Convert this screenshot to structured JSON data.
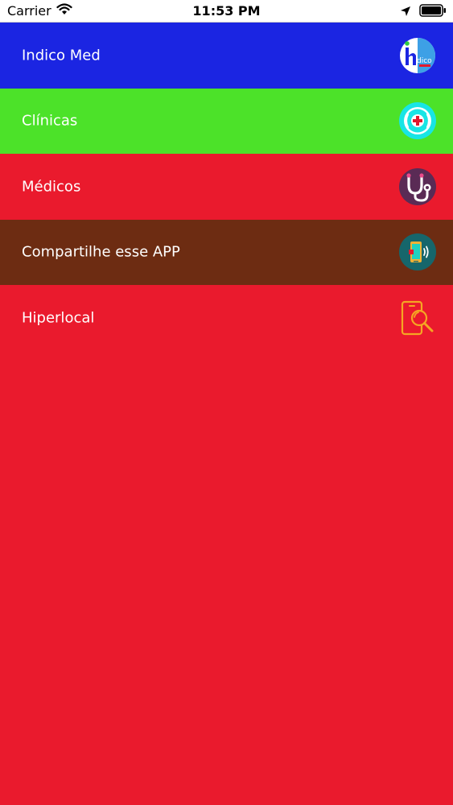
{
  "status_bar": {
    "carrier": "Carrier",
    "time": "11:53 PM",
    "icons": [
      "wifi-icon",
      "location-arrow-icon",
      "battery-icon"
    ]
  },
  "menu": {
    "items": [
      {
        "label": "Indico Med",
        "bg": "#1B25E2",
        "icon": "indico-logo-icon",
        "logo_text": "dico"
      },
      {
        "label": "Clínicas",
        "bg": "#4CE229",
        "icon": "clinic-signal-icon"
      },
      {
        "label": "Médicos",
        "bg": "#EA1A2D",
        "icon": "stethoscope-icon"
      },
      {
        "label": "Compartilhe esse APP",
        "bg": "#6D2C12",
        "icon": "share-phone-icon"
      },
      {
        "label": "Hiperlocal",
        "bg": "#EA1A2D",
        "icon": "phone-search-icon"
      }
    ]
  },
  "colors": {
    "background": "#EA1A2D",
    "text": "#FFFFFF"
  }
}
